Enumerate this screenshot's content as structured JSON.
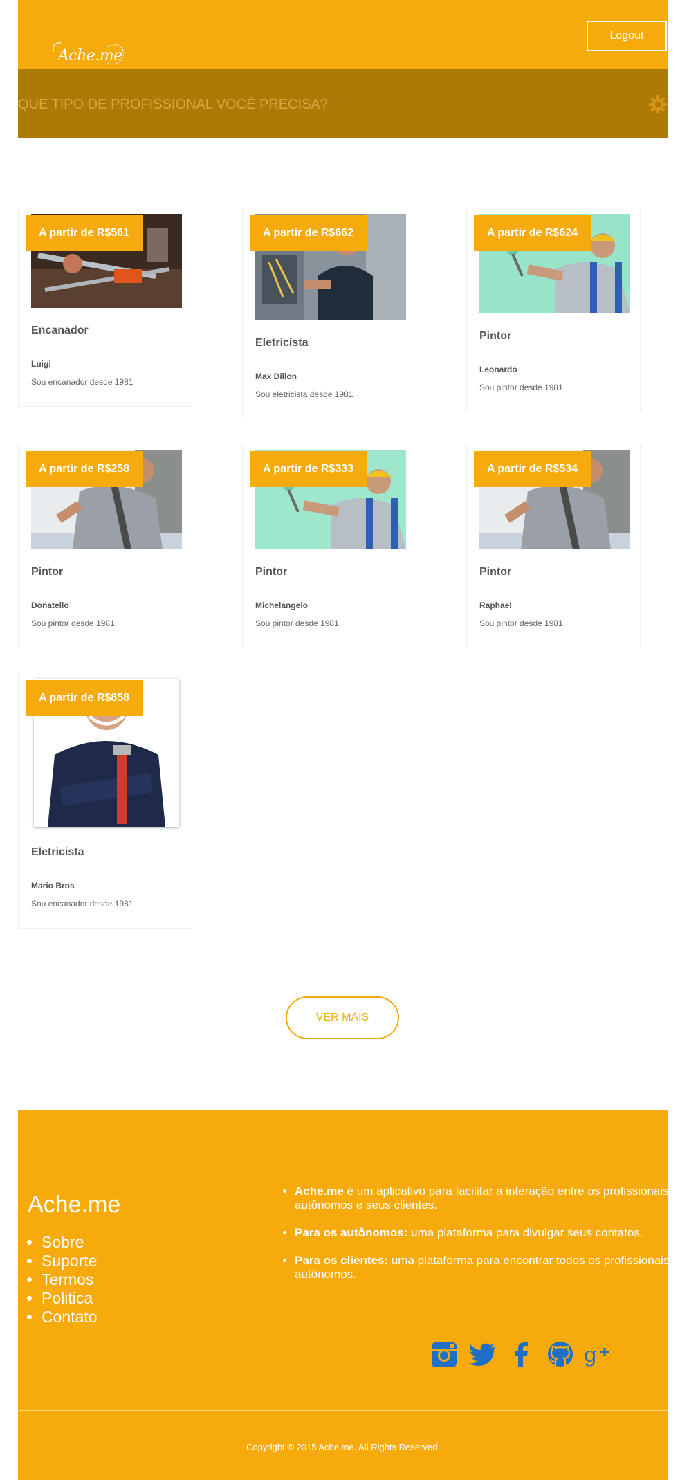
{
  "header": {
    "logo_text": "Ache.me",
    "logout_label": "Logout",
    "search_placeholder": "QUE TIPO DE PROFISSIONAL VOCÊ PRECISA?"
  },
  "cards": [
    {
      "price": "A partir de R$561",
      "title": "Encanador",
      "name": "Luigi",
      "desc": "Sou encanador desde 1981"
    },
    {
      "price": "A partir de R$662",
      "title": "Eletricista",
      "name": "Max Dillon",
      "desc": "Sou eletricista desde 1981"
    },
    {
      "price": "A partir de R$624",
      "title": "Pintor",
      "name": "Leonardo",
      "desc": "Sou pintor desde 1981"
    },
    {
      "price": "A partir de R$258",
      "title": "Pintor",
      "name": "Donatello",
      "desc": "Sou pintor desde 1981"
    },
    {
      "price": "A partir de R$333",
      "title": "Pintor",
      "name": "Michelangelo",
      "desc": "Sou pintor desde 1981"
    },
    {
      "price": "A partir de R$534",
      "title": "Pintor",
      "name": "Raphael",
      "desc": "Sou pintor desde 1981"
    },
    {
      "price": "A partir de R$858",
      "title": "Eletricista",
      "name": "Mario Bros",
      "desc": "Sou encanador desde 1981"
    }
  ],
  "ver_mais_label": "VER MAIS",
  "footer": {
    "brand": "Ache.me",
    "links": [
      "Sobre",
      "Suporte",
      "Termos",
      "Politica",
      "Contato"
    ],
    "info": [
      {
        "bold": "Ache.me",
        "text": " é um aplicativo para facilitar a interação entre os profissionais autônomos e seus clientes."
      },
      {
        "bold": "Para os autônomos:",
        "text": " uma plataforma para divulgar seus contatos."
      },
      {
        "bold": "Para os clientes:",
        "text": " uma plataforma para encontrar todos os profissionais autônomos."
      }
    ],
    "socials": [
      "instagram-icon",
      "twitter-icon",
      "facebook-icon",
      "github-icon",
      "google-plus-icon"
    ],
    "copyright": "Copyright © 2015 Ache.me. All Rights Reserved."
  },
  "colors": {
    "accent": "#f7aa0b",
    "search_bar": "#ad7a05",
    "social_icons": "#1f6fc7"
  }
}
